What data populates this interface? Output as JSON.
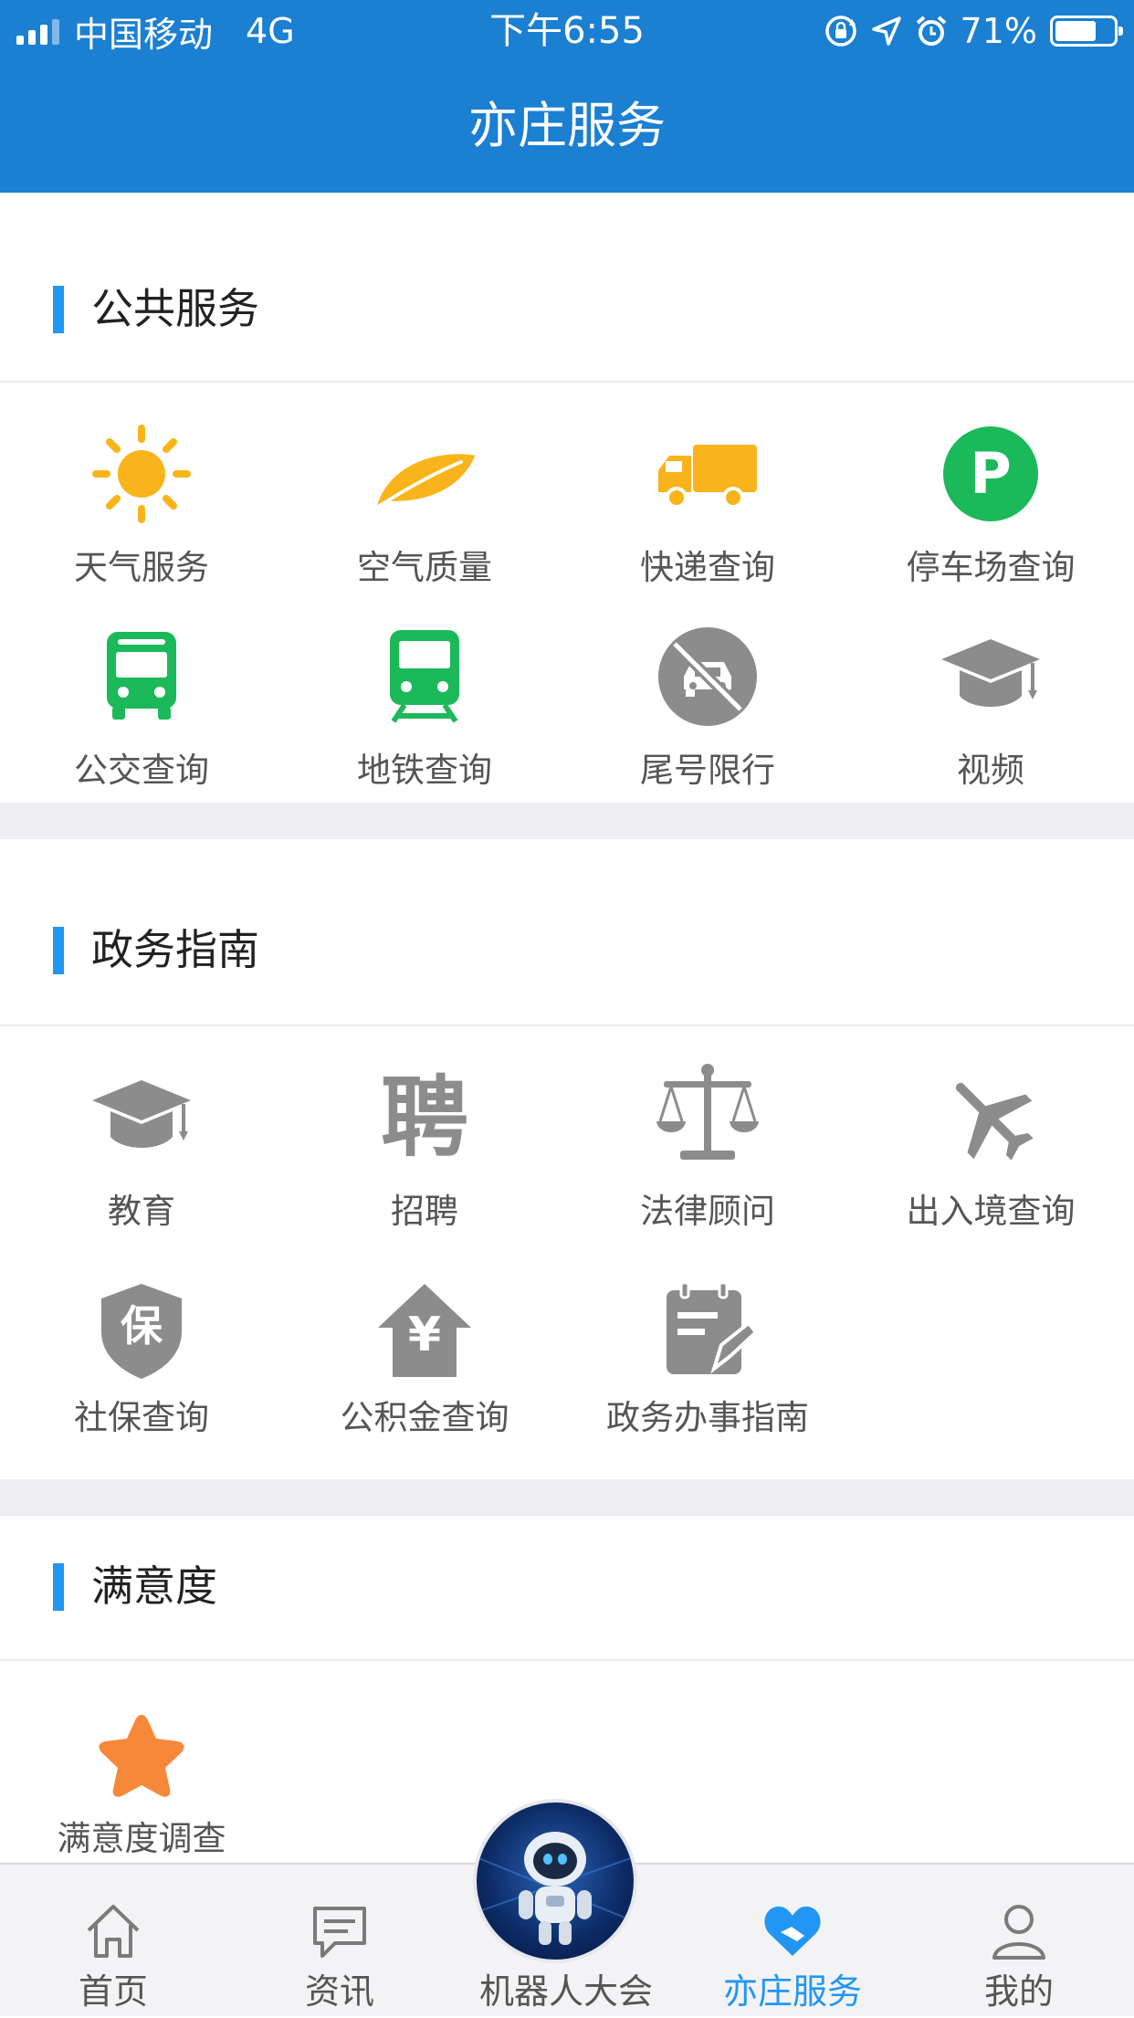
{
  "status_bar": {
    "carrier": "中国移动",
    "network": "4G",
    "time": "下午6:55",
    "battery": "71%",
    "battery_level": 0.71
  },
  "header": {
    "title": "亦庄服务"
  },
  "sections": [
    {
      "title": "公共服务",
      "items": [
        {
          "label": "天气服务",
          "icon": "sun-icon",
          "color": "#f8b41a"
        },
        {
          "label": "空气质量",
          "icon": "leaf-icon",
          "color": "#f8b41a"
        },
        {
          "label": "快递查询",
          "icon": "truck-icon",
          "color": "#f8b41a"
        },
        {
          "label": "停车场查询",
          "icon": "parking-icon",
          "color": "#1cb95a"
        },
        {
          "label": "公交查询",
          "icon": "bus-icon",
          "color": "#1cb95a"
        },
        {
          "label": "地铁查询",
          "icon": "subway-icon",
          "color": "#1cb95a"
        },
        {
          "label": "尾号限行",
          "icon": "no-car-icon",
          "color": "#8c8c8c"
        },
        {
          "label": "视频",
          "icon": "graduation-cap-icon",
          "color": "#8c8c8c"
        }
      ]
    },
    {
      "title": "政务指南",
      "items": [
        {
          "label": "教育",
          "icon": "graduation-cap-icon",
          "color": "#8c8c8c"
        },
        {
          "label": "招聘",
          "icon": "recruit-icon",
          "color": "#8c8c8c",
          "glyph": "聘"
        },
        {
          "label": "法律顾问",
          "icon": "scales-icon",
          "color": "#8c8c8c"
        },
        {
          "label": "出入境查询",
          "icon": "airplane-icon",
          "color": "#8c8c8c"
        },
        {
          "label": "社保查询",
          "icon": "shield-icon",
          "color": "#8c8c8c",
          "glyph": "保"
        },
        {
          "label": "公积金查询",
          "icon": "house-yen-icon",
          "color": "#8c8c8c",
          "glyph": "¥"
        },
        {
          "label": "政务办事指南",
          "icon": "notepad-icon",
          "color": "#8c8c8c"
        }
      ]
    },
    {
      "title": "满意度",
      "items": [
        {
          "label": "满意度调查",
          "icon": "star-icon",
          "color": "#f7883a"
        }
      ]
    }
  ],
  "tabbar": {
    "active": "亦庄服务",
    "active_color": "#2196f3",
    "tabs": [
      {
        "label": "首页",
        "icon": "home-icon"
      },
      {
        "label": "资讯",
        "icon": "message-icon"
      },
      {
        "label": "机器人大会",
        "icon": "robot-icon"
      },
      {
        "label": "亦庄服务",
        "icon": "heart-icon"
      },
      {
        "label": "我的",
        "icon": "user-icon"
      }
    ]
  }
}
